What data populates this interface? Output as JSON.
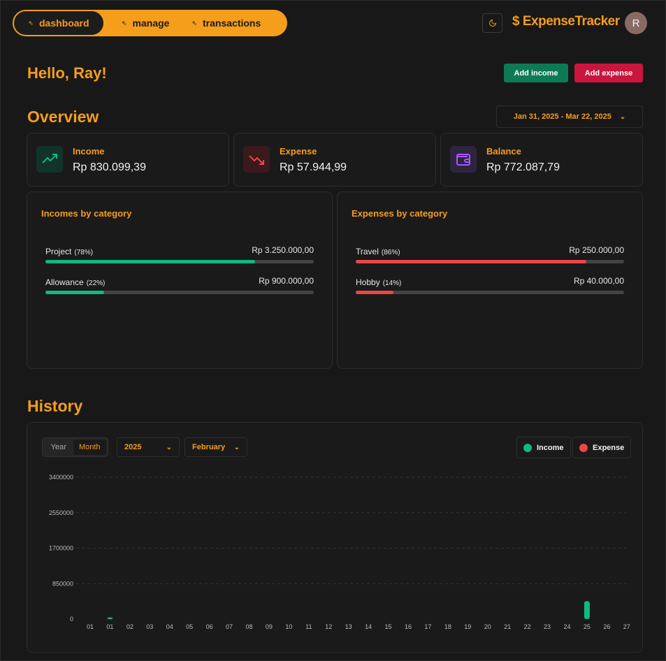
{
  "nav": {
    "items": [
      {
        "label": "dashboard",
        "active": true
      },
      {
        "label": "manage",
        "active": false
      },
      {
        "label": "transactions",
        "active": false
      }
    ]
  },
  "brand": {
    "name": "$ ExpenseTracker"
  },
  "user": {
    "initial": "R"
  },
  "greeting": "Hello, Ray!",
  "actions": {
    "add_income": "Add income",
    "add_expense": "Add expense"
  },
  "overview": {
    "title": "Overview",
    "date_range": "Jan 31, 2025 - Mar 22, 2025",
    "stats": [
      {
        "label": "Income",
        "value": "Rp 830.099,39",
        "icon": "trending-up-icon"
      },
      {
        "label": "Expense",
        "value": "Rp 57.944,99",
        "icon": "trending-down-icon"
      },
      {
        "label": "Balance",
        "value": "Rp 772.087,79",
        "icon": "wallet-icon"
      }
    ]
  },
  "incomes_by_category": {
    "title": "Incomes by category",
    "items": [
      {
        "name": "Project",
        "pct": "(78%)",
        "amount": "Rp 3.250.000,00",
        "fraction": 0.78
      },
      {
        "name": "Allowance",
        "pct": "(22%)",
        "amount": "Rp 900.000,00",
        "fraction": 0.22
      }
    ]
  },
  "expenses_by_category": {
    "title": "Expenses by category",
    "items": [
      {
        "name": "Travel",
        "pct": "(86%)",
        "amount": "Rp 250.000,00",
        "fraction": 0.86
      },
      {
        "name": "Hobby",
        "pct": "(14%)",
        "amount": "Rp 40.000,00",
        "fraction": 0.14
      }
    ]
  },
  "history": {
    "title": "History",
    "toggle": {
      "year": "Year",
      "month": "Month",
      "selected": "Month"
    },
    "year_select": "2025",
    "month_select": "February",
    "legend": {
      "income": "Income",
      "expense": "Expense"
    }
  },
  "colors": {
    "accent": "#f59e1c",
    "income": "#10b981",
    "expense": "#ef4444"
  },
  "chart_data": {
    "type": "bar",
    "categories": [
      "01",
      "01",
      "02",
      "03",
      "04",
      "05",
      "06",
      "07",
      "08",
      "09",
      "10",
      "11",
      "12",
      "13",
      "14",
      "15",
      "16",
      "17",
      "18",
      "19",
      "20",
      "21",
      "22",
      "23",
      "24",
      "25",
      "26",
      "27"
    ],
    "series": [
      {
        "name": "Income",
        "values": [
          0,
          40000,
          0,
          0,
          0,
          0,
          0,
          0,
          0,
          0,
          0,
          0,
          0,
          0,
          0,
          0,
          0,
          0,
          0,
          0,
          0,
          0,
          0,
          0,
          0,
          430000,
          0,
          0
        ]
      },
      {
        "name": "Expense",
        "values": [
          0,
          0,
          0,
          0,
          0,
          0,
          0,
          0,
          0,
          0,
          0,
          0,
          0,
          0,
          0,
          0,
          0,
          0,
          0,
          0,
          0,
          0,
          0,
          0,
          0,
          0,
          0,
          0
        ]
      }
    ],
    "yticks": [
      "3400000",
      "2550000",
      "1700000",
      "850000",
      "0"
    ],
    "ylim": [
      0,
      3400000
    ],
    "grid": true
  }
}
